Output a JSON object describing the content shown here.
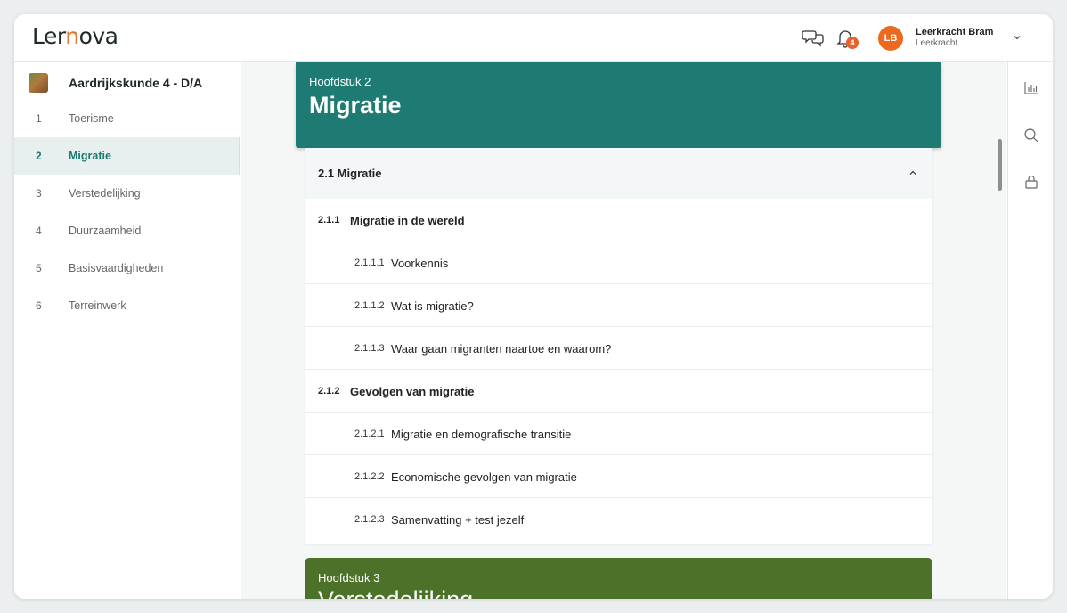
{
  "app": {
    "logo_left": "Ler",
    "logo_dot": "n",
    "logo_right": "ova"
  },
  "header": {
    "notification_count": "4",
    "avatar_initials": "LB",
    "user_name": "Leerkracht Bram",
    "user_role": "Leerkracht"
  },
  "sidebar": {
    "course_title": "Aardrijkskunde 4 - D/A",
    "items": [
      {
        "num": "1",
        "label": "Toerisme"
      },
      {
        "num": "2",
        "label": "Migratie"
      },
      {
        "num": "3",
        "label": "Verstedelijking"
      },
      {
        "num": "4",
        "label": "Duurzaamheid"
      },
      {
        "num": "5",
        "label": "Basisvaardigheden"
      },
      {
        "num": "6",
        "label": "Terreinwerk"
      }
    ]
  },
  "chapter": {
    "subtitle": "Hoofdstuk 2",
    "title": "Migratie",
    "section": "2.1  Migratie",
    "subsections": [
      {
        "num": "2.1.1",
        "title": "Migratie in de wereld",
        "lessons": [
          {
            "num": "2.1.1.1",
            "title": "Voorkennis"
          },
          {
            "num": "2.1.1.2",
            "title": "Wat is migratie?"
          },
          {
            "num": "2.1.1.3",
            "title": "Waar gaan migranten naartoe en waarom?"
          }
        ]
      },
      {
        "num": "2.1.2",
        "title": "Gevolgen van migratie",
        "lessons": [
          {
            "num": "2.1.2.1",
            "title": "Migratie en demografische transitie"
          },
          {
            "num": "2.1.2.2",
            "title": "Economische gevolgen van migratie"
          },
          {
            "num": "2.1.2.3",
            "title": "Samenvatting + test jezelf"
          }
        ]
      }
    ]
  },
  "next_chapter": {
    "subtitle": "Hoofdstuk 3",
    "title": "Verstedelijking"
  },
  "colors": {
    "chapter2": "#1e7b73",
    "chapter3": "#4c7129",
    "accent": "#ec6a1f"
  },
  "icons": {
    "chat": "chat-bubbles-icon",
    "notifications": "bell-icon",
    "user_menu": "chevron-down-icon",
    "section_toggle": "chevron-up-icon",
    "rail": [
      "bar-chart-icon",
      "search-icon",
      "lock-icon"
    ]
  }
}
